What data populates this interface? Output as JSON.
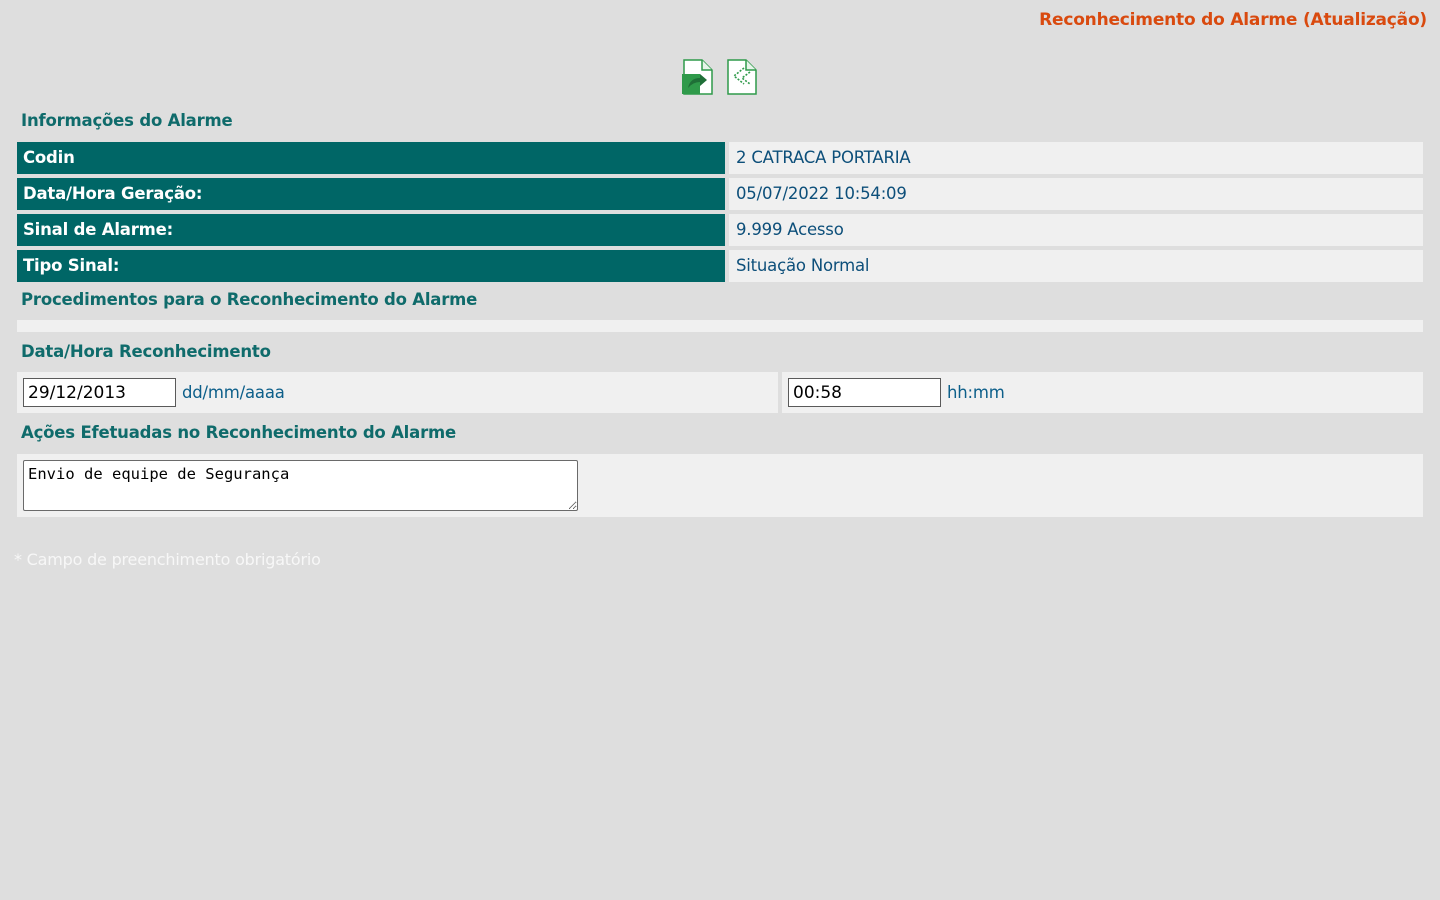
{
  "header": {
    "title": "Reconhecimento do Alarme (Atualização)"
  },
  "toolbar": {
    "buttons": [
      {
        "name": "save-document-icon"
      },
      {
        "name": "back-document-icon"
      }
    ]
  },
  "alarm_info": {
    "heading": "Informações do Alarme",
    "rows": [
      {
        "label": "Codin",
        "value": "2 CATRACA PORTARIA"
      },
      {
        "label": "Data/Hora Geração:",
        "value": "05/07/2022 10:54:09"
      },
      {
        "label": "Sinal de Alarme:",
        "value": "9.999 Acesso"
      },
      {
        "label": "Tipo Sinal:",
        "value": "Situação Normal"
      }
    ]
  },
  "procedures": {
    "heading": "Procedimentos para o Reconhecimento do Alarme"
  },
  "acknowledgement": {
    "heading": "Data/Hora Reconhecimento",
    "date_value": "29/12/2013",
    "date_hint": "dd/mm/aaaa",
    "time_value": "00:58",
    "time_hint": "hh:mm"
  },
  "actions": {
    "heading": "Ações Efetuadas no Reconhecimento do Alarme",
    "text": "Envio de equipe de Segurança"
  },
  "footer": {
    "required_note": "* Campo de preenchimento obrigatório"
  },
  "colors": {
    "title": "#d94a0f",
    "heading": "#0f6b6b",
    "label_bg": "#006666",
    "value_text": "#0d4f7a"
  }
}
